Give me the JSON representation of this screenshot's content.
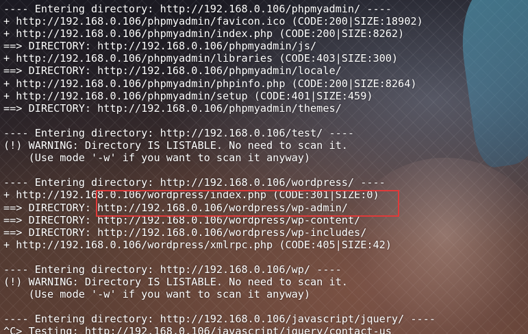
{
  "terminal": {
    "lines": [
      "---- Entering directory: http://192.168.0.106/phpmyadmin/ ----",
      "+ http://192.168.0.106/phpmyadmin/favicon.ico (CODE:200|SIZE:18902)",
      "+ http://192.168.0.106/phpmyadmin/index.php (CODE:200|SIZE:8262)",
      "==> DIRECTORY: http://192.168.0.106/phpmyadmin/js/",
      "+ http://192.168.0.106/phpmyadmin/libraries (CODE:403|SIZE:300)",
      "==> DIRECTORY: http://192.168.0.106/phpmyadmin/locale/",
      "+ http://192.168.0.106/phpmyadmin/phpinfo.php (CODE:200|SIZE:8264)",
      "+ http://192.168.0.106/phpmyadmin/setup (CODE:401|SIZE:459)",
      "==> DIRECTORY: http://192.168.0.106/phpmyadmin/themes/",
      "",
      "---- Entering directory: http://192.168.0.106/test/ ----",
      "(!) WARNING: Directory IS LISTABLE. No need to scan it.",
      "    (Use mode '-w' if you want to scan it anyway)",
      "",
      "---- Entering directory: http://192.168.0.106/wordpress/ ----",
      "+ http://192.168.0.106/wordpress/index.php (CODE:301|SIZE:0)",
      "==> DIRECTORY: http://192.168.0.106/wordpress/wp-admin/",
      "==> DIRECTORY: http://192.168.0.106/wordpress/wp-content/",
      "==> DIRECTORY: http://192.168.0.106/wordpress/wp-includes/",
      "+ http://192.168.0.106/wordpress/xmlrpc.php (CODE:405|SIZE:42)",
      "",
      "---- Entering directory: http://192.168.0.106/wp/ ----",
      "(!) WARNING: Directory IS LISTABLE. No need to scan it.",
      "    (Use mode '-w' if you want to scan it anyway)",
      "",
      "---- Entering directory: http://192.168.0.106/javascript/jquery/ ----",
      "^C> Testing: http://192.168.0.106/javascript/jquery/contact-us"
    ]
  },
  "colors": {
    "text": "#ffffff",
    "highlight_border": "#e03a3a"
  }
}
